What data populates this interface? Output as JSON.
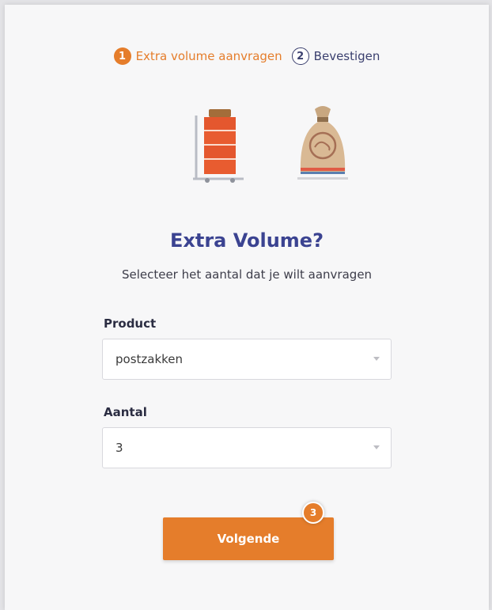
{
  "steps": [
    {
      "number": "1",
      "label": "Extra volume aanvragen"
    },
    {
      "number": "2",
      "label": "Bevestigen"
    }
  ],
  "illustrations": {
    "left": "mail-trolley-icon",
    "right": "mail-sack-icon"
  },
  "heading": "Extra Volume?",
  "subtitle": "Selecteer het aantal dat je wilt aanvragen",
  "product": {
    "label": "Product",
    "value": "postzakken"
  },
  "quantity": {
    "label": "Aantal",
    "value": "3"
  },
  "next_button": {
    "label": "Volgende"
  },
  "badge": "3",
  "colors": {
    "accent": "#e57d2b",
    "heading": "#3b4391",
    "step_inactive": "#3a3f6e"
  }
}
